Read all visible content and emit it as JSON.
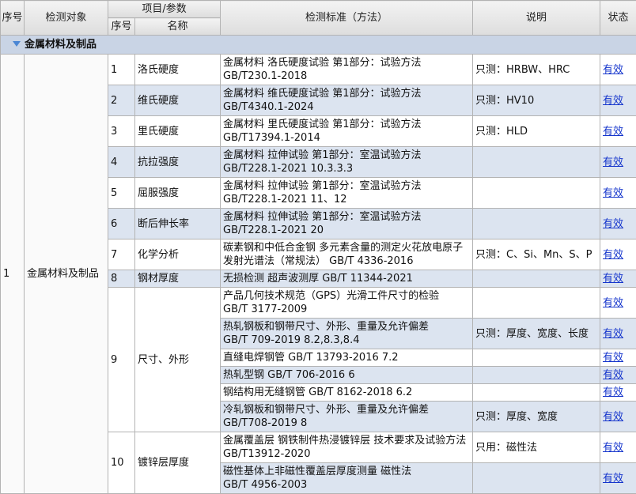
{
  "header": {
    "object_index": "序号",
    "object_name": "检测对象",
    "item_group": "项目/参数",
    "item_index": "序号",
    "item_name": "名称",
    "standard": "检测标准（方法）",
    "note": "说明",
    "status": "状态"
  },
  "group": {
    "label": "金属材料及制品",
    "toggle_icon": "triangle-down-icon"
  },
  "object": {
    "index": "1",
    "name": "金属材料及制品"
  },
  "items": [
    {
      "index": "1",
      "name": "洛氏硬度",
      "standards": [
        {
          "name": "金属材料 洛氏硬度试验 第1部分：试验方法",
          "code": "GB/T230.1-2018",
          "note": "只测：HRBW、HRC",
          "status": "有效"
        }
      ]
    },
    {
      "index": "2",
      "name": "维氏硬度",
      "standards": [
        {
          "name": "金属材料 维氏硬度试验 第1部分：试验方法",
          "code": "GB/T4340.1-2024",
          "note": "只测：HV10",
          "status": "有效"
        }
      ]
    },
    {
      "index": "3",
      "name": "里氏硬度",
      "standards": [
        {
          "name": "金属材料 里氏硬度试验 第1部分：试验方法",
          "code": "GB/T17394.1-2014",
          "note": "只测：HLD",
          "status": "有效"
        }
      ]
    },
    {
      "index": "4",
      "name": "抗拉强度",
      "standards": [
        {
          "name": "金属材料 拉伸试验 第1部分：室温试验方法",
          "code": "GB/T228.1-2021 10.3.3.3",
          "status": "有效"
        }
      ]
    },
    {
      "index": "5",
      "name": "屈服强度",
      "standards": [
        {
          "name": "金属材料 拉伸试验 第1部分：室温试验方法",
          "code": "GB/T228.1-2021 11、12",
          "status": "有效"
        }
      ]
    },
    {
      "index": "6",
      "name": "断后伸长率",
      "standards": [
        {
          "name": "金属材料 拉伸试验 第1部分：室温试验方法",
          "code": "GB/T228.1-2021 20",
          "status": "有效"
        }
      ]
    },
    {
      "index": "7",
      "name": "化学分析",
      "standards": [
        {
          "name": "碳素钢和中低合金钢 多元素含量的测定火花放电原子发射光谱法（常规法）",
          "code": "GB/T 4336-2016",
          "note": "只测：C、Si、Mn、S、P",
          "status": "有效"
        }
      ]
    },
    {
      "index": "8",
      "name": "钢材厚度",
      "standards": [
        {
          "name": "无损检测 超声波测厚",
          "code": "GB/T 11344-2021",
          "status": "有效"
        }
      ]
    },
    {
      "index": "9",
      "name": "尺寸、外形",
      "standards": [
        {
          "name": "产品几何技术规范（GPS）光滑工件尺寸的检验",
          "code": "GB/T 3177-2009",
          "status": "有效"
        },
        {
          "name": "热轧钢板和钢带尺寸、外形、重量及允许偏差",
          "code": "GB/T 709-2019 8.2,8.3,8.4",
          "note": "只测：厚度、宽度、长度",
          "status": "有效"
        },
        {
          "name": "直缝电焊钢管",
          "code": "GB/T 13793-2016 7.2",
          "status": "有效"
        },
        {
          "name": "热轧型钢",
          "code": "GB/T 706-2016 6",
          "status": "有效"
        },
        {
          "name": "钢结构用无缝钢管",
          "code": "GB/T 8162-2018 6.2",
          "status": "有效"
        },
        {
          "name": "冷轧钢板和钢带尺寸、外形、重量及允许偏差",
          "code": "GB/T708-2019 8",
          "note": "只测：厚度、宽度",
          "status": "有效"
        }
      ]
    },
    {
      "index": "10",
      "name": "镀锌层厚度",
      "standards": [
        {
          "name": "金属覆盖层 钢铁制件热浸镀锌层 技术要求及试验方法",
          "code": "GB/T13912-2020",
          "note": "只用：磁性法",
          "status": "有效"
        },
        {
          "name": "磁性基体上非磁性覆盖层厚度测量 磁性法",
          "code": "GB/T 4956-2003",
          "status": "有效"
        }
      ]
    }
  ],
  "colors": {
    "header_bg": "#dddddd",
    "group_bg": "#c9d4e5",
    "row_alt_bg": "#dce4f0",
    "border": "#b3b3b3",
    "link": "#1535cc",
    "icon_blue": "#4a86d4"
  }
}
